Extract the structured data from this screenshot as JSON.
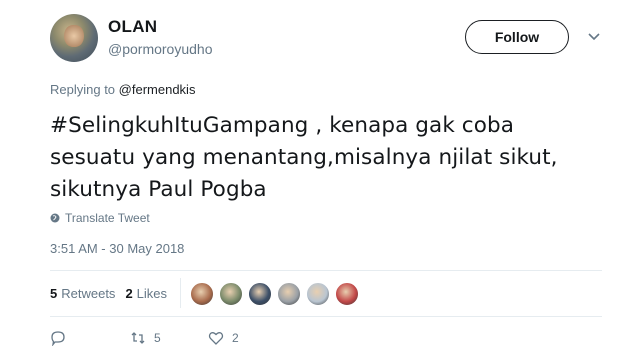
{
  "user": {
    "display_name": "OLAN",
    "screen_name": "@pormoroyudho"
  },
  "follow_button": {
    "label": "Follow"
  },
  "reply": {
    "prefix": "Replying to",
    "handle": "@fermendkis"
  },
  "tweet": {
    "line1": "#SelingkuhItuGampang , kenapa gak coba",
    "line2": "sesuatu yang menantang,misalnya njilat sikut,",
    "line3": "sikutnya Paul Pogba"
  },
  "translate_label": "Translate Tweet",
  "timestamp": "3:51 AM - 30 May 2018",
  "stats": {
    "retweets_count": "5",
    "retweets_label": "Retweets",
    "likes_count": "2",
    "likes_label": "Likes"
  },
  "likers": [
    {
      "name": "liker-1",
      "color": "#a86b4c"
    },
    {
      "name": "liker-2",
      "color": "#7a8a6a"
    },
    {
      "name": "liker-3",
      "color": "#3c4f68"
    },
    {
      "name": "liker-4",
      "color": "#9aa0a6"
    },
    {
      "name": "liker-5",
      "color": "#b9c5d1"
    },
    {
      "name": "liker-6",
      "color": "#c24848"
    }
  ],
  "actions": {
    "reply_count": "",
    "retweet_count": "5",
    "like_count": "2"
  },
  "colors": {
    "secondary_text": "#657786",
    "primary_text": "#14171a",
    "divider": "#e6ecf0"
  }
}
